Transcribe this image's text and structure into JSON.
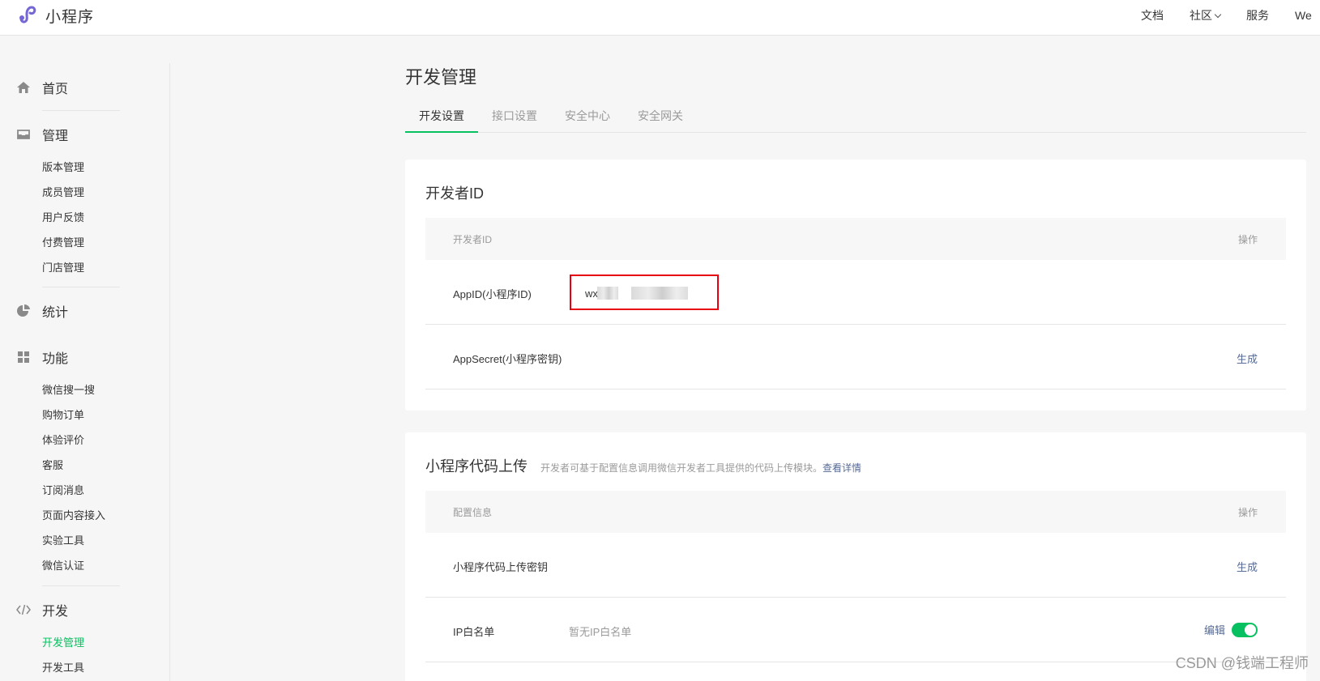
{
  "brand": {
    "name": "小程序",
    "logo_icon": "miniprogram-logo-icon"
  },
  "topnav": {
    "items": [
      {
        "label": "文档"
      },
      {
        "label": "社区",
        "has_dropdown": true
      },
      {
        "label": "服务"
      },
      {
        "label": "We"
      }
    ]
  },
  "sidebar": {
    "sections": [
      {
        "label": "首页",
        "icon": "home-icon",
        "items": []
      },
      {
        "label": "管理",
        "icon": "inbox-icon",
        "items": [
          "版本管理",
          "成员管理",
          "用户反馈",
          "付费管理",
          "门店管理"
        ]
      },
      {
        "label": "统计",
        "icon": "pie-chart-icon",
        "items": []
      },
      {
        "label": "功能",
        "icon": "grid-icon",
        "items": [
          "微信搜一搜",
          "购物订单",
          "体验评价",
          "客服",
          "订阅消息",
          "页面内容接入",
          "实验工具",
          "微信认证"
        ]
      },
      {
        "label": "开发",
        "icon": "code-icon",
        "items": [
          "开发管理",
          "开发工具"
        ],
        "active_item": "开发管理"
      }
    ]
  },
  "main": {
    "title": "开发管理",
    "tabs": [
      {
        "label": "开发设置",
        "active": true
      },
      {
        "label": "接口设置",
        "active": false
      },
      {
        "label": "安全中心",
        "active": false
      },
      {
        "label": "安全网关",
        "active": false
      }
    ],
    "developer_card": {
      "title": "开发者ID",
      "header": {
        "col1": "开发者ID",
        "col2": "操作"
      },
      "rows": [
        {
          "label": "AppID(小程序ID)",
          "value_prefix": "wx"
        },
        {
          "label": "AppSecret(小程序密钥)",
          "action": "生成"
        }
      ]
    },
    "upload_card": {
      "title": "小程序代码上传",
      "desc": "开发者可基于配置信息调用微信开发者工具提供的代码上传模块。",
      "desc_link": "查看详情",
      "header": {
        "col1": "配置信息",
        "col2": "操作"
      },
      "rows": [
        {
          "label": "小程序代码上传密钥",
          "action": "生成"
        },
        {
          "label": "IP白名单",
          "value": "暂无IP白名单",
          "action": "编辑",
          "toggle_on": true
        }
      ]
    }
  },
  "watermark": "CSDN @钱端工程师",
  "colors": {
    "accent": "#07c160",
    "link": "#576b95",
    "highlight_box": "#e60012"
  }
}
